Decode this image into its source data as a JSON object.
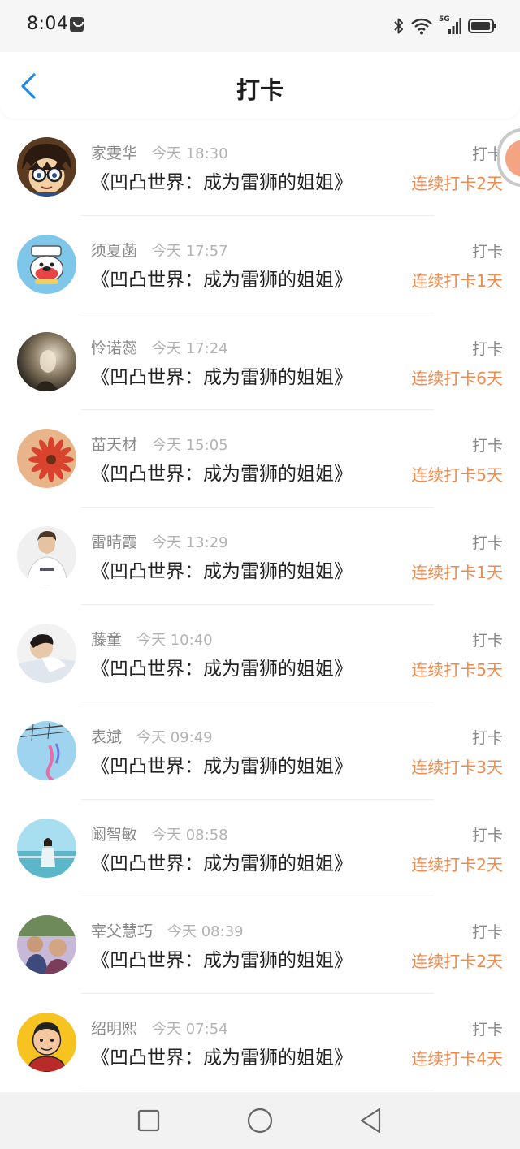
{
  "status_bar": {
    "time": "8:04",
    "network": "5G",
    "icons": [
      "notification-icon",
      "bluetooth-icon",
      "wifi-icon",
      "signal-icon",
      "battery-icon"
    ]
  },
  "header": {
    "title": "打卡",
    "back_icon": "chevron-left-icon",
    "accent_color": "#1e88e5"
  },
  "list": {
    "book_title": "《凹凸世界：成为雷狮的姐姐》",
    "action_label": "打卡",
    "streak_color": "#f08a4b",
    "items": [
      {
        "name": "家雯华",
        "time": "今天 18:30",
        "book": "《凹凸世界：成为雷狮的姐姐》",
        "action": "打卡",
        "streak": "连续打卡2天",
        "avatar": "anime-boy-glasses"
      },
      {
        "name": "须夏菡",
        "time": "今天 17:57",
        "book": "《凹凸世界：成为雷狮的姐姐》",
        "action": "打卡",
        "streak": "连续打卡1天",
        "avatar": "cartoon-monkey"
      },
      {
        "name": "怜诺蕊",
        "time": "今天 17:24",
        "book": "《凹凸世界：成为雷狮的姐姐》",
        "action": "打卡",
        "streak": "连续打卡6天",
        "avatar": "dark-photo"
      },
      {
        "name": "苗天材",
        "time": "今天 15:05",
        "book": "《凹凸世界：成为雷狮的姐姐》",
        "action": "打卡",
        "streak": "连续打卡5天",
        "avatar": "red-flower"
      },
      {
        "name": "雷晴霞",
        "time": "今天 13:29",
        "book": "《凹凸世界：成为雷狮的姐姐》",
        "action": "打卡",
        "streak": "连续打卡1天",
        "avatar": "man-white-shirt"
      },
      {
        "name": "藤童",
        "time": "今天 10:40",
        "book": "《凹凸世界：成为雷狮的姐姐》",
        "action": "打卡",
        "streak": "连续打卡5天",
        "avatar": "man-lying"
      },
      {
        "name": "表斌",
        "time": "今天 09:49",
        "book": "《凹凸世界：成为雷狮的姐姐》",
        "action": "打卡",
        "streak": "连续打卡3天",
        "avatar": "sky-kite"
      },
      {
        "name": "阚智敏",
        "time": "今天 08:58",
        "book": "《凹凸世界：成为雷狮的姐姐》",
        "action": "打卡",
        "streak": "连续打卡2天",
        "avatar": "girl-seaside"
      },
      {
        "name": "宰父慧巧",
        "time": "今天 08:39",
        "book": "《凹凸世界：成为雷狮的姐姐》",
        "action": "打卡",
        "streak": "连续打卡2天",
        "avatar": "group-photo"
      },
      {
        "name": "绍明熙",
        "time": "今天 07:54",
        "book": "《凹凸世界：成为雷狮的姐姐》",
        "action": "打卡",
        "streak": "连续打卡4天",
        "avatar": "cartoon-man-yellow"
      }
    ]
  },
  "nav_bar": {
    "buttons": [
      "recent-apps-icon",
      "home-icon",
      "back-triangle-icon"
    ]
  }
}
